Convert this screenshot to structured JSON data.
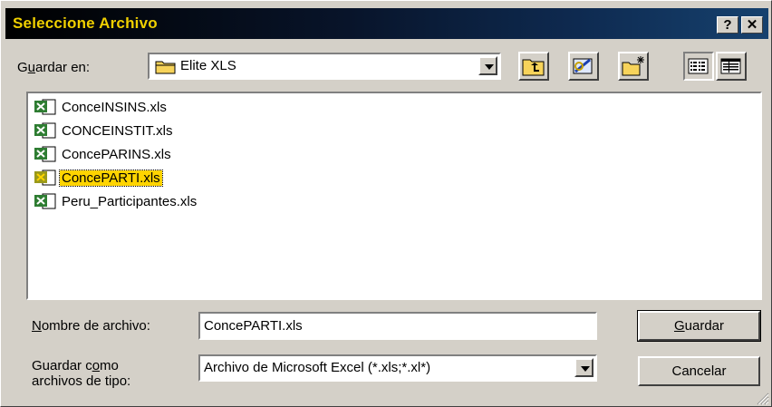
{
  "window": {
    "title": "Seleccione Archivo",
    "help_label": "?",
    "close_label": "✕"
  },
  "location": {
    "label": "Guardar en:",
    "label_accesskey_index": 1,
    "value": "Elite XLS"
  },
  "toolbar": {
    "buttons": [
      {
        "name": "up-one-level-icon"
      },
      {
        "name": "search-web-icon"
      },
      {
        "name": "new-folder-icon"
      },
      {
        "name": "list-view-icon"
      },
      {
        "name": "details-view-icon"
      }
    ]
  },
  "files": [
    {
      "name": "ConceINSINS.xls",
      "selected": false
    },
    {
      "name": "CONCEINSTIT.xls",
      "selected": false
    },
    {
      "name": "ConcePARINS.xls",
      "selected": false
    },
    {
      "name": "ConcePARTI.xls",
      "selected": true
    },
    {
      "name": "Peru_Participantes.xls",
      "selected": false
    }
  ],
  "filename": {
    "label": "Nombre de archivo:",
    "value": "ConcePARTI.xls"
  },
  "filetype": {
    "label_line1": "Guardar como",
    "label_line2": "archivos de tipo:",
    "value": "Archivo de Microsoft Excel (*.xls;*.xl*)"
  },
  "buttons": {
    "save": "Guardar",
    "cancel": "Cancelar"
  },
  "colors": {
    "title_text": "#f0d000",
    "selection": "#ffd400",
    "excel_green": "#2e7d32"
  }
}
